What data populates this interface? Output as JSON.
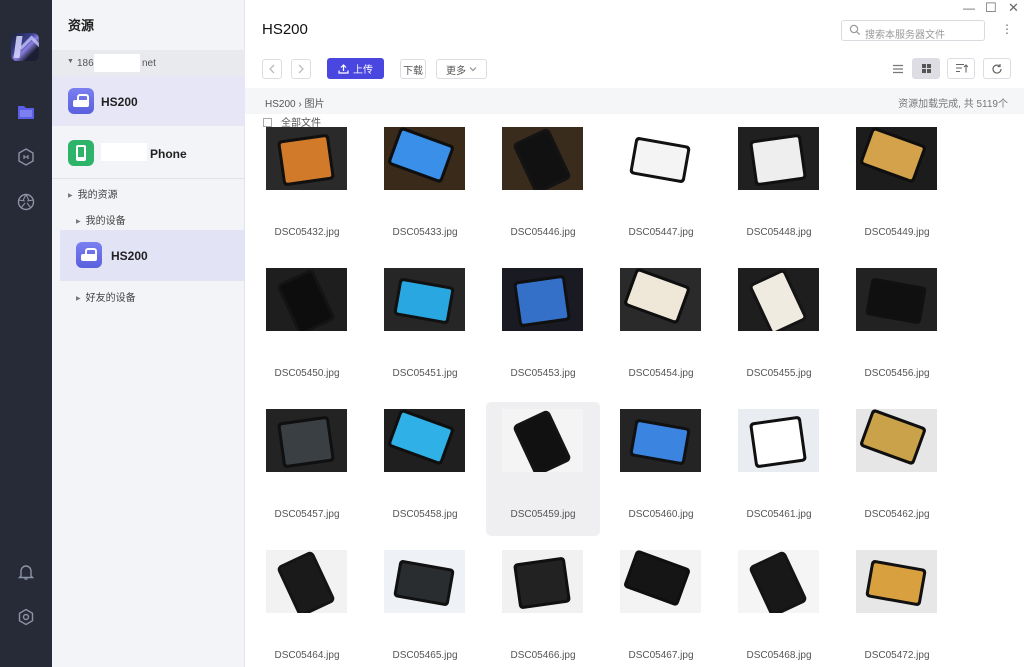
{
  "sidebar": {
    "nav": [
      "files-icon",
      "hub-icon",
      "aperture-icon",
      "bell-icon",
      "settings-hex-icon"
    ],
    "panel_title": "资源",
    "account_prefix": "186",
    "account_suffix": "net",
    "devices": [
      {
        "name": "HS200",
        "icon": "nas-device-icon",
        "selected": true
      },
      {
        "name": "Phone",
        "icon": "phone-device-icon",
        "selected": false
      }
    ],
    "tree": {
      "my_resources": "我的资源",
      "my_devices": "我的设备",
      "device": "HS200",
      "friends_devices": "好友的设备"
    }
  },
  "main": {
    "title": "HS200",
    "search_placeholder": "搜索本服务器文件",
    "toolbar": {
      "upload": "上传",
      "download": "下载",
      "more": "更多"
    },
    "breadcrumb": {
      "root": "HS200",
      "sep": "›",
      "current": "图片"
    },
    "status": "资源加载完成, 共 5119个",
    "select_all": "全部文件",
    "files": [
      {
        "name": "DSC05432.jpg",
        "bg": "#2a2a2a",
        "screen": "#d07a2a"
      },
      {
        "name": "DSC05433.jpg",
        "bg": "#3a2a1a",
        "screen": "#3a8fe8"
      },
      {
        "name": "DSC05446.jpg",
        "bg": "#3a2c1c",
        "screen": "#111"
      },
      {
        "name": "DSC05447.jpg",
        "bg": "#ffffff",
        "screen": "#f4f4f4"
      },
      {
        "name": "DSC05448.jpg",
        "bg": "#202020",
        "screen": "#eeeeee"
      },
      {
        "name": "DSC05449.jpg",
        "bg": "#1c1c1c",
        "screen": "#d4a24a"
      },
      {
        "name": "DSC05450.jpg",
        "bg": "#1e1e1e",
        "screen": "#0d0d0d"
      },
      {
        "name": "DSC05451.jpg",
        "bg": "#262626",
        "screen": "#29a7e0"
      },
      {
        "name": "DSC05453.jpg",
        "bg": "#1a1a22",
        "screen": "#3570c8"
      },
      {
        "name": "DSC05454.jpg",
        "bg": "#2a2a2a",
        "screen": "#efe8d8"
      },
      {
        "name": "DSC05455.jpg",
        "bg": "#1e1e1e",
        "screen": "#f0ebe0"
      },
      {
        "name": "DSC05456.jpg",
        "bg": "#222222",
        "screen": "#101010"
      },
      {
        "name": "DSC05457.jpg",
        "bg": "#232323",
        "screen": "#3a3f44"
      },
      {
        "name": "DSC05458.jpg",
        "bg": "#1f1f1f",
        "screen": "#2fb0e6"
      },
      {
        "name": "DSC05459.jpg",
        "bg": "#f4f4f4",
        "screen": "#111111"
      },
      {
        "name": "DSC05460.jpg",
        "bg": "#242424",
        "screen": "#3b84e0"
      },
      {
        "name": "DSC05461.jpg",
        "bg": "#e9edf2",
        "screen": "#ffffff"
      },
      {
        "name": "DSC05462.jpg",
        "bg": "#e6e6e6",
        "screen": "#c9a24a"
      },
      {
        "name": "DSC05464.jpg",
        "bg": "#f2f2f2",
        "screen": "#1a1a1a"
      },
      {
        "name": "DSC05465.jpg",
        "bg": "#eef2f6",
        "screen": "#2a2d30"
      },
      {
        "name": "DSC05466.jpg",
        "bg": "#f1f1f1",
        "screen": "#222"
      },
      {
        "name": "DSC05467.jpg",
        "bg": "#f3f3f3",
        "screen": "#151515"
      },
      {
        "name": "DSC05468.jpg",
        "bg": "#f5f5f5",
        "screen": "#181818"
      },
      {
        "name": "DSC05472.jpg",
        "bg": "#e7e7e7",
        "screen": "#d9a040"
      }
    ],
    "highlighted_file": "DSC05459.jpg"
  },
  "colors": {
    "rail": "#272b37",
    "accent": "#4a47e0",
    "selection": "#e6e6f7"
  }
}
